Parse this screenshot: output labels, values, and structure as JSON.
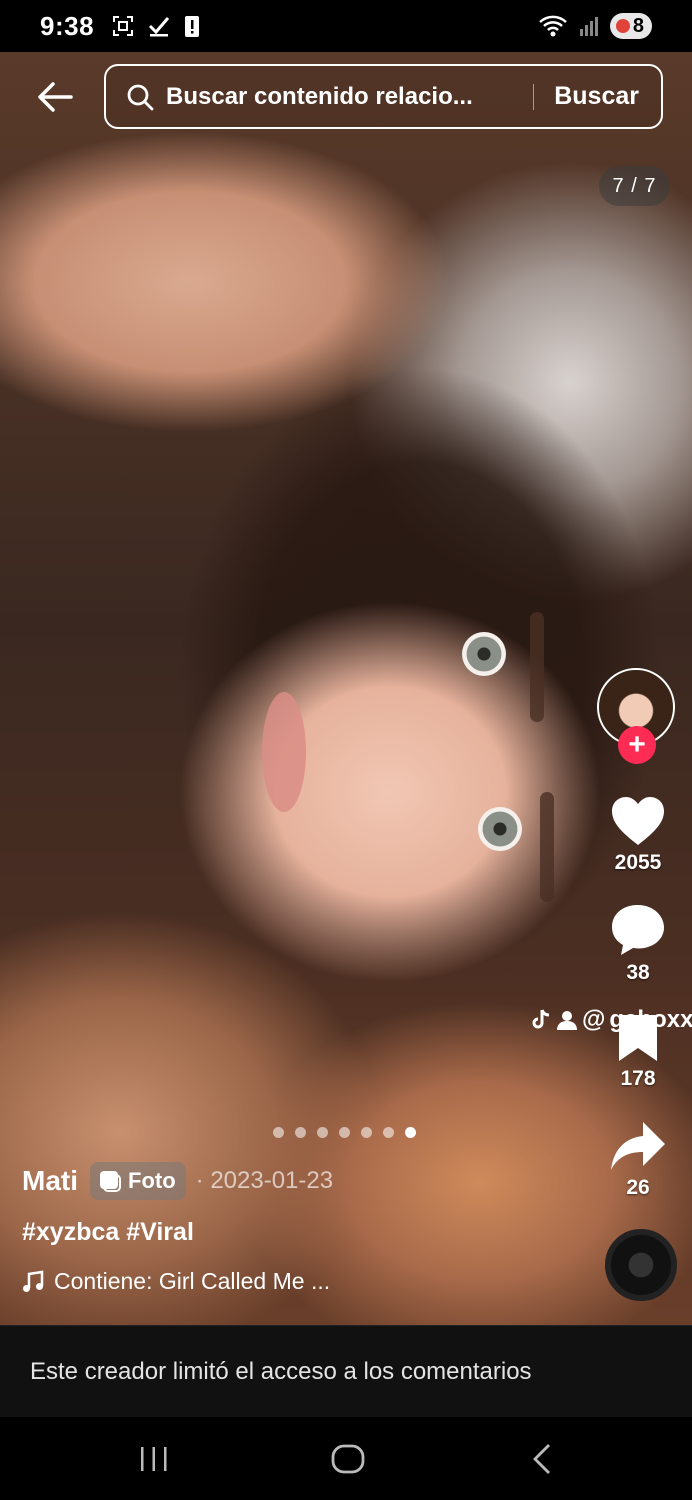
{
  "status_bar": {
    "time": "9:38",
    "battery": "8",
    "icons_left": [
      "screenshot-icon",
      "check-icon",
      "alert-icon"
    ],
    "icons_right": [
      "wifi-icon",
      "signal-icon",
      "battery-icon"
    ]
  },
  "search": {
    "placeholder": "Buscar contenido relacio...",
    "button_label": "Buscar"
  },
  "page_counter": "7 / 7",
  "slides": {
    "total": 7,
    "current": 7
  },
  "rail": {
    "likes": "2055",
    "comments": "38",
    "saves": "178",
    "shares": "26",
    "follow_symbol": "+"
  },
  "mention_tag": "gaboxx",
  "caption": {
    "author": "Mati",
    "type_badge": "Foto",
    "date": "· 2023-01-23",
    "hashtags": "#xyzbca #Viral",
    "music": "Contiene: Girl Called Me ..."
  },
  "comments_notice": "Este creador limitó el acceso a los comentarios",
  "colors": {
    "follow": "#fe2c55",
    "background": "#000000"
  }
}
